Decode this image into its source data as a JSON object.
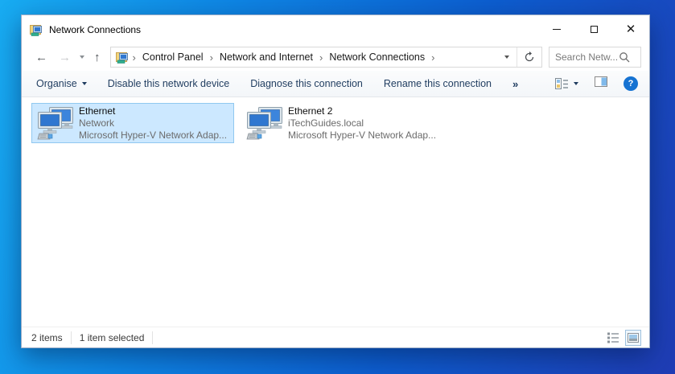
{
  "window": {
    "title": "Network Connections",
    "controls": {
      "minimize": "minimize",
      "maximize": "maximize",
      "close": "close"
    }
  },
  "nav": {
    "breadcrumb": {
      "separator": "›",
      "items": [
        "Control Panel",
        "Network and Internet",
        "Network Connections"
      ]
    },
    "search": {
      "placeholder": "Search Netw..."
    }
  },
  "toolbar": {
    "organise_label": "Organise",
    "actions": [
      "Disable this network device",
      "Diagnose this connection",
      "Rename this connection"
    ],
    "more_label": "»",
    "help_glyph": "?"
  },
  "items": [
    {
      "name": "Ethernet",
      "status": "Network",
      "device": "Microsoft Hyper-V Network Adap...",
      "selected": true
    },
    {
      "name": "Ethernet 2",
      "status": "iTechGuides.local",
      "device": "Microsoft Hyper-V Network Adap...",
      "selected": false
    }
  ],
  "statusbar": {
    "items_count": "2 items",
    "selection": "1 item selected"
  },
  "colors": {
    "selection_bg": "#cce8ff",
    "selection_border": "#90c8f0",
    "toolbar_text": "#1f3c5f",
    "help_accent": "#1673d2",
    "desktop_top_left": "#18acf2",
    "desktop_bottom_right": "#1f3cb4"
  }
}
